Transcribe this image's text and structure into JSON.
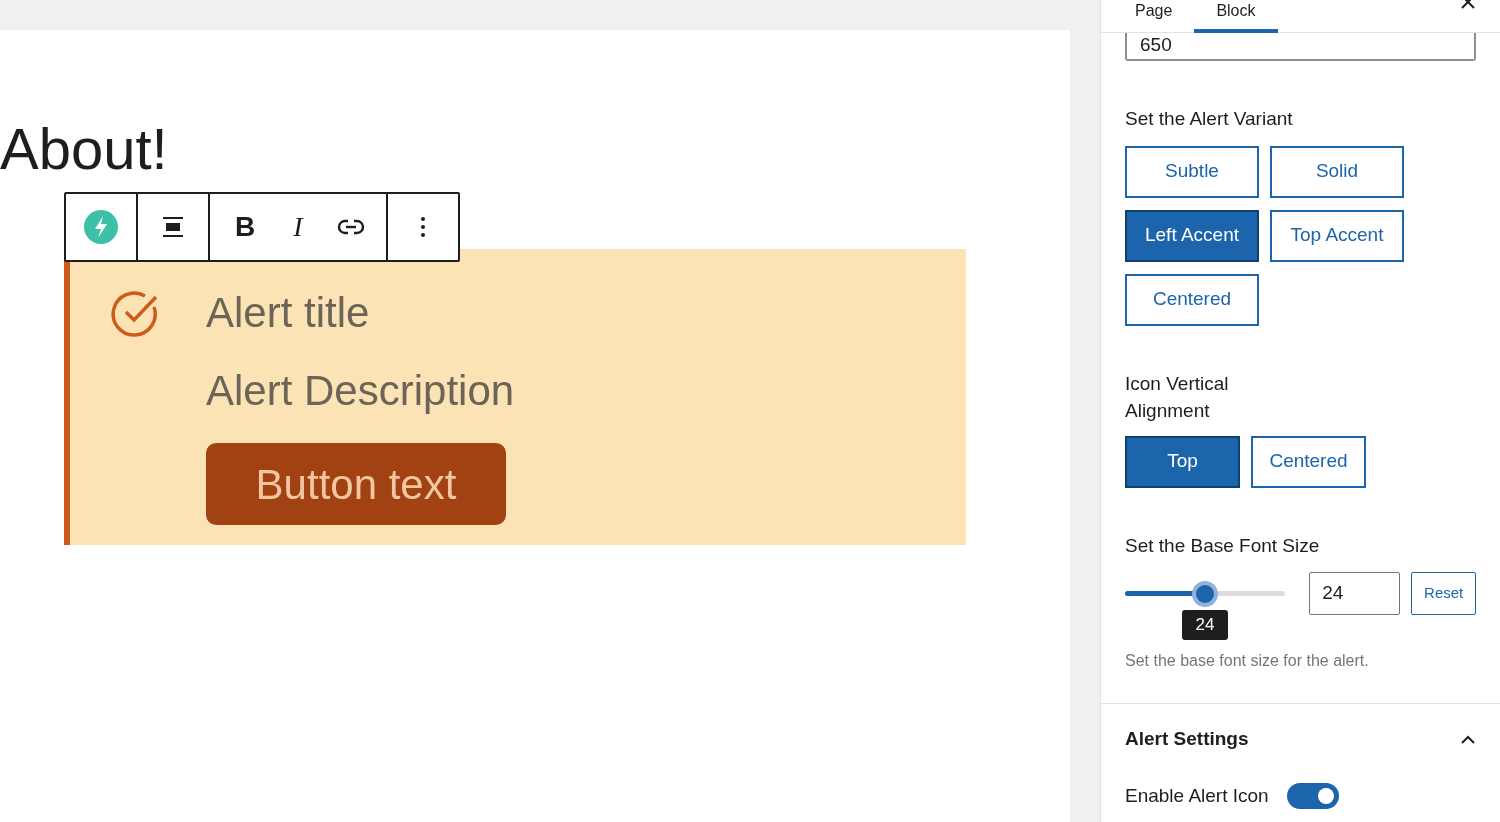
{
  "canvas": {
    "heading": "About!",
    "toolbar": {
      "buttons": [
        {
          "kind": "block"
        },
        {
          "kind": "align"
        },
        {
          "kind": "bold",
          "label": "B"
        },
        {
          "kind": "italic",
          "label": "I"
        },
        {
          "kind": "link"
        },
        {
          "kind": "more"
        }
      ]
    },
    "alert": {
      "title": "Alert title",
      "description": "Alert Description",
      "button": "Button text"
    }
  },
  "sidebar": {
    "tabs": [
      {
        "label": "Page",
        "selected": false
      },
      {
        "label": "Block",
        "selected": true
      }
    ],
    "number_field": {
      "value": "650"
    },
    "variant": {
      "label": "Set the Alert Variant",
      "options": [
        {
          "label": "Subtle",
          "selected": false
        },
        {
          "label": "Solid",
          "selected": false
        },
        {
          "label": "Left Accent",
          "selected": true
        },
        {
          "label": "Top Accent",
          "selected": false
        },
        {
          "label": "Centered",
          "selected": false
        }
      ]
    },
    "icon_alignment": {
      "label": "Icon Vertical Alignment",
      "options": [
        {
          "label": "Top",
          "selected": true
        },
        {
          "label": "Centered",
          "selected": false
        }
      ]
    },
    "font_size": {
      "label": "Set the Base Font Size",
      "level": 0.5,
      "tooltip": "24",
      "value": "24",
      "reset": "Reset",
      "help": "Set the base font size for the alert."
    },
    "alert_settings": {
      "title": "Alert Settings",
      "expanded": true,
      "toggles": [
        {
          "label": "Enable Alert Icon",
          "on": true
        }
      ]
    }
  }
}
